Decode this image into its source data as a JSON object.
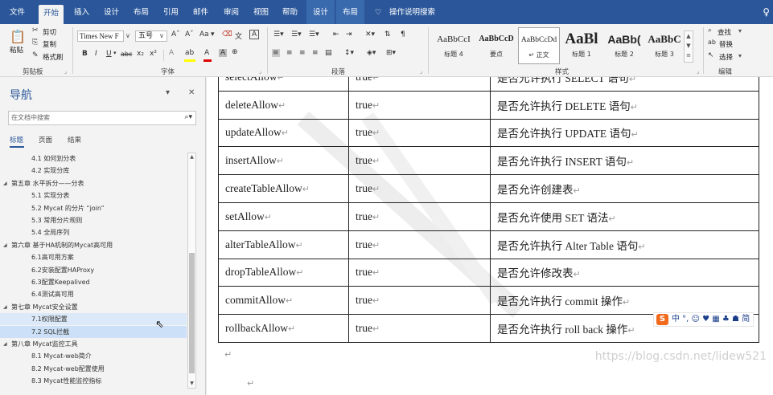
{
  "tabs": [
    {
      "id": "file",
      "label": "文件"
    },
    {
      "id": "home",
      "label": "开始"
    },
    {
      "id": "insert",
      "label": "插入"
    },
    {
      "id": "design",
      "label": "设计"
    },
    {
      "id": "layout",
      "label": "布局"
    },
    {
      "id": "references",
      "label": "引用"
    },
    {
      "id": "mailings",
      "label": "邮件"
    },
    {
      "id": "review",
      "label": "审阅"
    },
    {
      "id": "view",
      "label": "视图"
    },
    {
      "id": "help",
      "label": "帮助"
    },
    {
      "id": "table-design",
      "label": "设计"
    },
    {
      "id": "table-layout",
      "label": "布局"
    },
    {
      "id": "tellme",
      "label": "操作说明搜索"
    }
  ],
  "ribbon": {
    "clipboard": {
      "paste": "粘贴",
      "cut": "剪切",
      "copy": "复制",
      "format_painter": "格式刷",
      "label": "剪贴板"
    },
    "font": {
      "name": "Times New F",
      "size": "五号",
      "label": "字体",
      "aa_label": "Aa",
      "clear_label": "A",
      "highlight_label": "ab",
      "font_color_label": "A",
      "char_shade_label": "A",
      "phonetic_label": "文",
      "border_char_label": "A"
    },
    "paragraph": {
      "label": "段落"
    },
    "styles": {
      "label": "样式",
      "items": [
        {
          "preview": "AaBbCcI",
          "name": "标题 4"
        },
        {
          "preview": "AaBbCcD",
          "name": "要点"
        },
        {
          "preview": "AaBbCcDd",
          "name": "↵ 正文"
        },
        {
          "preview": "AaBl",
          "name": "标题 1"
        },
        {
          "preview": "AaBb(",
          "name": "标题 2"
        },
        {
          "preview": "AaBbC",
          "name": "标题 3"
        }
      ]
    },
    "editing": {
      "find": "查找",
      "replace": "替换",
      "select": "选择",
      "label": "编辑"
    }
  },
  "nav": {
    "title": "导航",
    "search_placeholder": "在文档中搜索",
    "tabs": [
      "标题",
      "页面",
      "结果"
    ],
    "items": [
      {
        "text": "4.1 如何划分表",
        "level": 2
      },
      {
        "text": "4.2 实现分库",
        "level": 2
      },
      {
        "text": "第五章 水平拆分——分表",
        "level": 1
      },
      {
        "text": "5.1 实现分表",
        "level": 2
      },
      {
        "text": "5.2 Mycat 的分片 “join”",
        "level": 2
      },
      {
        "text": "5.3 常用分片规则",
        "level": 2
      },
      {
        "text": "5.4 全局序列",
        "level": 2
      },
      {
        "text": "第六章 基于HA机制的Mycat高可用",
        "level": 1
      },
      {
        "text": "6.1高可用方案",
        "level": 2
      },
      {
        "text": "6.2安装配置HAProxy",
        "level": 2
      },
      {
        "text": "6.3配置Keepalived",
        "level": 2
      },
      {
        "text": "6.4测试高可用",
        "level": 2
      },
      {
        "text": "第七章 Mycat安全设置",
        "level": 1
      },
      {
        "text": "7.1权限配置",
        "level": 2
      },
      {
        "text": "7.2 SQL拦截",
        "level": 2
      },
      {
        "text": "第八章 Mycat监控工具",
        "level": 1
      },
      {
        "text": "8.1 Mycat-web简介",
        "level": 2
      },
      {
        "text": "8.2 Mycat-web配置使用",
        "level": 2
      },
      {
        "text": "8.3 Mycat性能监控指标",
        "level": 2
      }
    ],
    "hover_index": 13,
    "selected_index": 14
  },
  "document": {
    "table": [
      {
        "name": "selectAllow",
        "value": "true",
        "desc": "是否允许执行 SELECT 语句"
      },
      {
        "name": "deleteAllow",
        "value": "true",
        "desc": "是否允许执行 DELETE 语句"
      },
      {
        "name": "updateAllow",
        "value": "true",
        "desc": "是否允许执行 UPDATE 语句"
      },
      {
        "name": "insertAllow",
        "value": "true",
        "desc": "是否允许执行 INSERT 语句"
      },
      {
        "name": "createTableAllow",
        "value": "true",
        "desc": "是否允许创建表"
      },
      {
        "name": "setAllow",
        "value": "true",
        "desc": "是否允许使用 SET 语法"
      },
      {
        "name": "alterTableAllow",
        "value": "true",
        "desc": "是否允许执行 Alter Table 语句"
      },
      {
        "name": "dropTableAllow",
        "value": "true",
        "desc": "是否允许修改表"
      },
      {
        "name": "commitAllow",
        "value": "true",
        "desc": "是否允许执行 commit 操作"
      },
      {
        "name": "rollbackAllow",
        "value": "true",
        "desc": "是否允许执行 roll back 操作"
      }
    ],
    "return_mark": "↵",
    "watermark_url": "https://blog.csdn.net/lidew521",
    "ime_text": "中 °, ☺ ♥ ▦ ♣ ☗ 简",
    "ime_logo": "S"
  },
  "colors": {
    "ribbon_blue": "#2b579a",
    "selected_nav": "#cce1f7"
  }
}
